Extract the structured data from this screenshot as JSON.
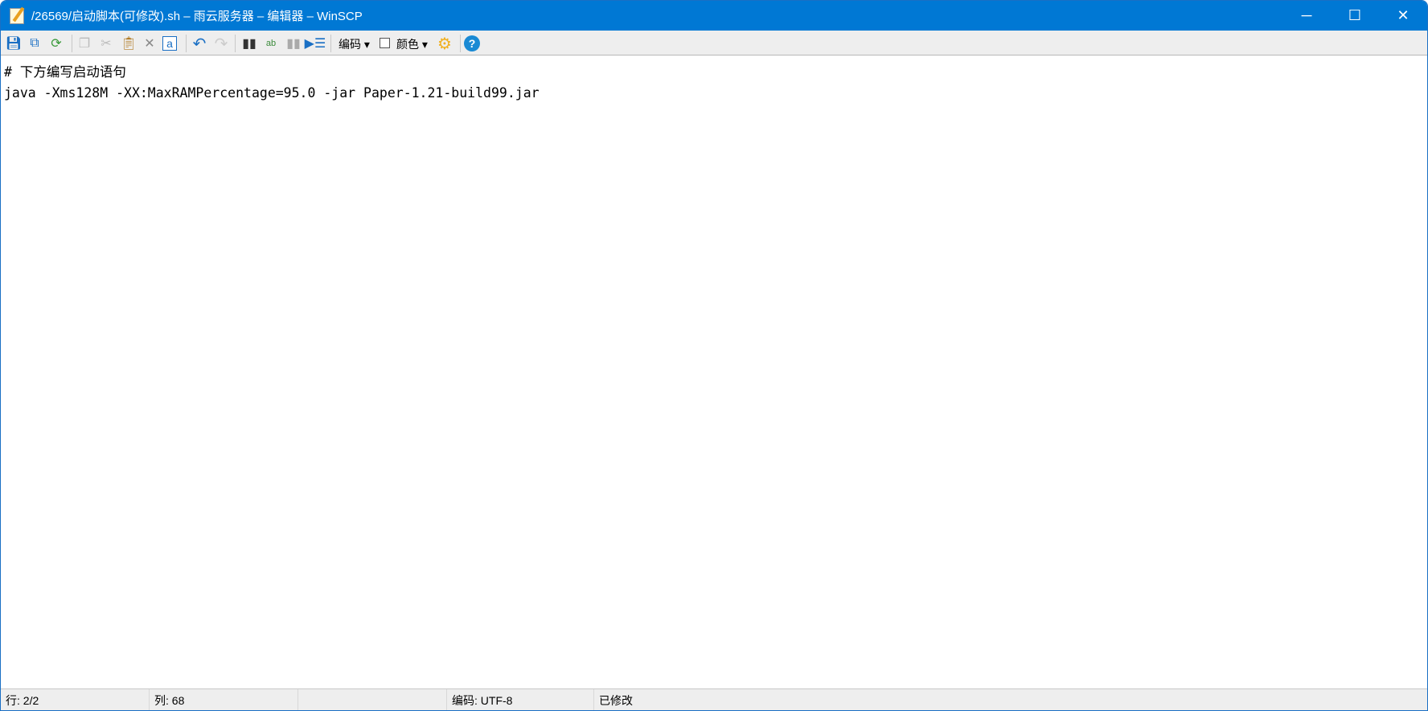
{
  "window": {
    "title": "/26569/启动脚本(可修改).sh – 雨云服务器 – 编辑器 – WinSCP"
  },
  "toolbar": {
    "encoding_label": "编码",
    "color_label": "颜色"
  },
  "editor": {
    "lines": [
      "# 下方编写启动语句",
      "java -Xms128M -XX:MaxRAMPercentage=95.0 -jar Paper-1.21-build99.jar"
    ]
  },
  "status": {
    "line": "行: 2/2",
    "column": "列: 68",
    "empty": "",
    "encoding": "编码: UTF-8",
    "modified": "已修改"
  },
  "colors": {
    "titlebar": "#0078d4",
    "toolbar": "#eeeeee"
  }
}
